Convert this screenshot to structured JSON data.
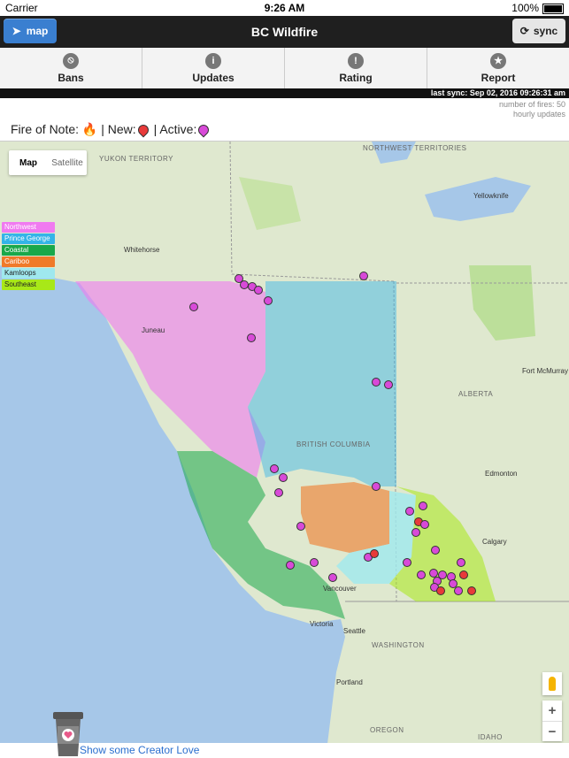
{
  "status_bar": {
    "carrier": "Carrier",
    "time": "9:26 AM",
    "battery": "100%"
  },
  "header": {
    "title": "BC Wildfire",
    "map_button": "map",
    "sync_button": "sync"
  },
  "tabs": [
    {
      "label": "Bans",
      "icon": "ban-icon"
    },
    {
      "label": "Updates",
      "icon": "info-icon"
    },
    {
      "label": "Rating",
      "icon": "warning-icon"
    },
    {
      "label": "Report",
      "icon": "star-icon"
    }
  ],
  "sync_bar": {
    "text": "last sync: Sep 02, 2016 09:26:31 am"
  },
  "meta": {
    "fires": "number of fires: 50",
    "updates": "hourly updates"
  },
  "legend": {
    "fire_of_note": "Fire of Note:",
    "new": "| New:",
    "active": "| Active:"
  },
  "map": {
    "toggle_map": "Map",
    "toggle_satellite": "Satellite",
    "regions": [
      {
        "name": "Northwest",
        "color": "#f07af0"
      },
      {
        "name": "Prince George",
        "color": "#34b4e8"
      },
      {
        "name": "Coastal",
        "color": "#1aa84a"
      },
      {
        "name": "Cariboo",
        "color": "#f07a2a"
      },
      {
        "name": "Kamloops",
        "color": "#9fe8ee"
      },
      {
        "name": "Southeast",
        "color": "#a8e818"
      }
    ],
    "labels": {
      "yukon": "YUKON TERRITORY",
      "nwt": "NORTHWEST TERRITORIES",
      "bc": "BRITISH COLUMBIA",
      "alberta": "ALBERTA",
      "washington": "WASHINGTON",
      "idaho": "IDAHO",
      "oregon": "OREGON",
      "whitehorse": "Whitehorse",
      "juneau": "Juneau",
      "yellowknife": "Yellowknife",
      "fort_mcmurray": "Fort McMurray",
      "edmonton": "Edmonton",
      "calgary": "Calgary",
      "vancouver": "Vancouver",
      "victoria": "Victoria",
      "seattle": "Seattle",
      "portland": "Portland"
    }
  },
  "footer": {
    "link": "Show some Creator Love"
  }
}
